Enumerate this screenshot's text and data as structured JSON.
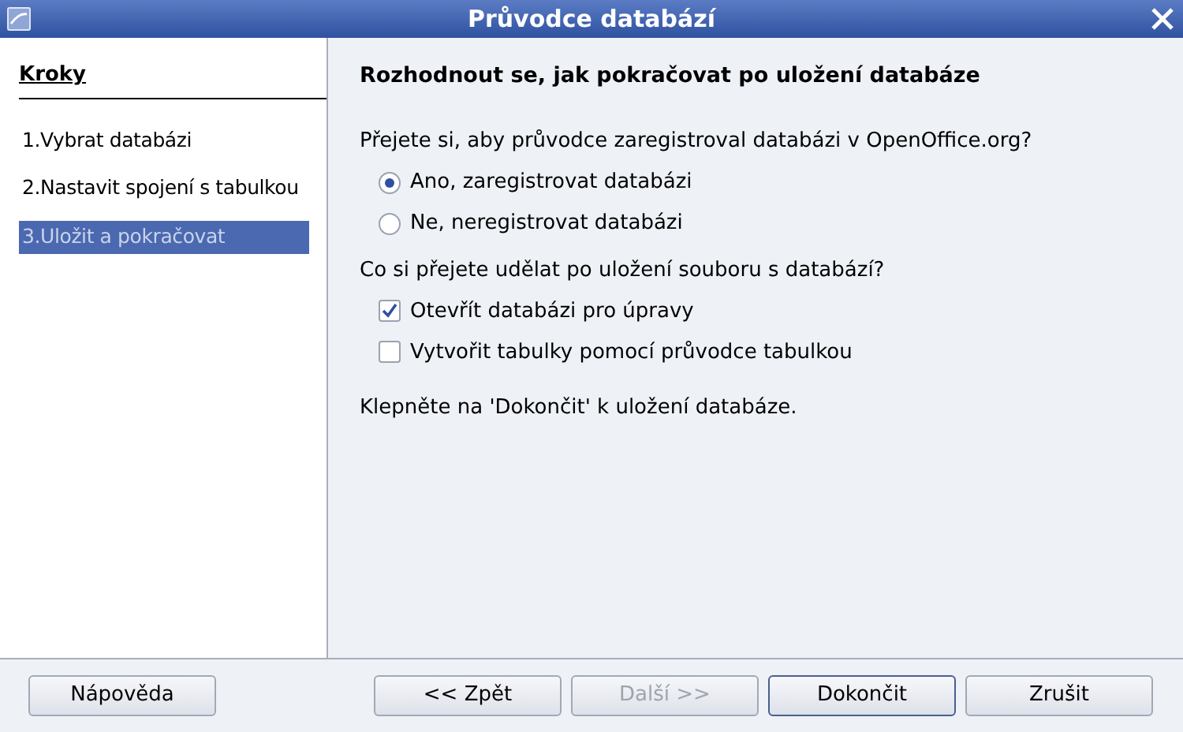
{
  "window": {
    "title": "Průvodce databází"
  },
  "sidebar": {
    "heading": "Kroky",
    "items": [
      {
        "label": "1.Vybrat databázi",
        "selected": false
      },
      {
        "label": "2.Nastavit spojení s tabulkou",
        "selected": false
      },
      {
        "label": "3.Uložit a pokračovat",
        "selected": true
      }
    ]
  },
  "page": {
    "title": "Rozhodnout se, jak pokračovat po uložení databáze",
    "register_question": "Přejete si, aby průvodce zaregistroval databázi v OpenOffice.org?",
    "register_options": [
      {
        "label": "Ano, zaregistrovat databázi",
        "selected": true
      },
      {
        "label": "Ne, neregistrovat databázi",
        "selected": false
      }
    ],
    "after_question": "Co si přejete udělat po uložení souboru s databází?",
    "after_options": [
      {
        "label": "Otevřít databázi pro úpravy",
        "checked": true
      },
      {
        "label": "Vytvořit tabulky pomocí průvodce tabulkou",
        "checked": false
      }
    ],
    "note": "Klepněte na 'Dokončit' k uložení databáze."
  },
  "buttons": [
    {
      "label": "Nápověda",
      "disabled": false,
      "default": false
    },
    {
      "label": "<< Zpět",
      "disabled": false,
      "default": false
    },
    {
      "label": "Další >>",
      "disabled": true,
      "default": false
    },
    {
      "label": "Dokončit",
      "disabled": false,
      "default": true
    },
    {
      "label": "Zrušit",
      "disabled": false,
      "default": false
    }
  ]
}
